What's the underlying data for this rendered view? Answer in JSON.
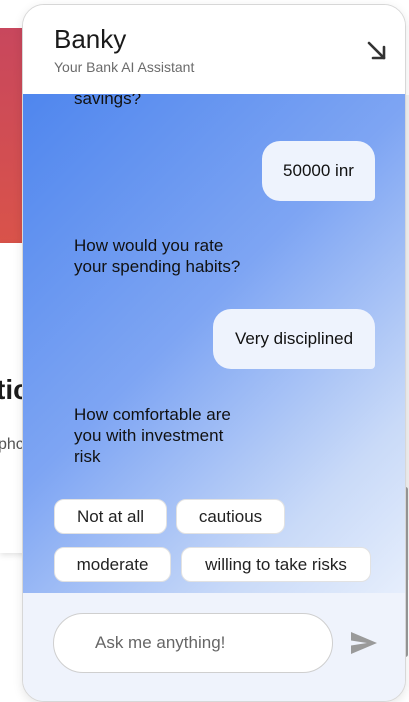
{
  "background_page": {
    "heading_fragment": "tic",
    "sub_fragment": "phc"
  },
  "chat": {
    "title": "Banky",
    "subtitle": "Your Bank AI Assistant",
    "minimize_icon": "arrow-down-right-icon",
    "messages": [
      {
        "from": "bot",
        "text": "savings?"
      },
      {
        "from": "user",
        "text": "50000 inr"
      },
      {
        "from": "bot",
        "text": "How would you rate your spending habits?"
      },
      {
        "from": "user",
        "text": "Very disciplined"
      },
      {
        "from": "bot",
        "text": "How comfortable are you with investment risk"
      }
    ],
    "options": [
      "Not at all",
      "cautious",
      "moderate",
      "willing to take risks"
    ],
    "input": {
      "placeholder": "Ask me anything!",
      "value": ""
    },
    "send_icon": "send-icon",
    "colors": {
      "gradient_start": "#4f86ee",
      "gradient_end": "#e6eefc",
      "bubble": "#eef3fd",
      "footer": "#eff3fc",
      "background_card": "#c8475d"
    }
  }
}
